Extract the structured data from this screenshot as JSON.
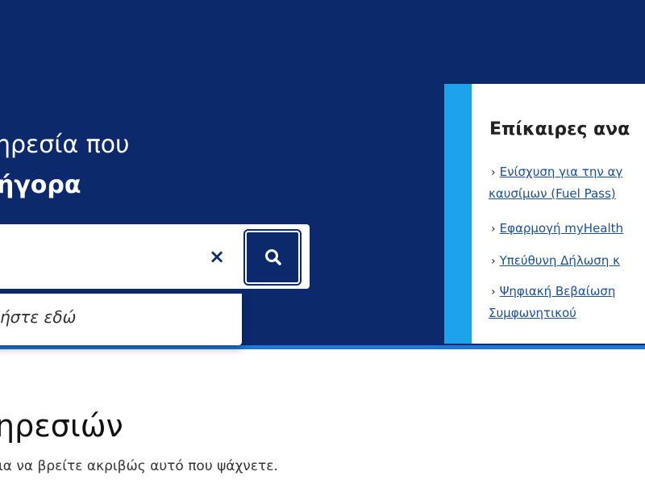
{
  "hero": {
    "line1": "ηρεσία που",
    "line2": "ήγορα"
  },
  "search": {
    "value": "",
    "clear_label": "×",
    "search_icon": "search-icon"
  },
  "dropdown": {
    "hint": "ήστε εδώ"
  },
  "news": {
    "title": "Επίκαιρες ανα",
    "items": [
      {
        "line1": "Ενίσχυση για την αγ",
        "line2": "καυσίμων (Fuel Pass)"
      },
      {
        "line1": "Εφαρμογή myHealth"
      },
      {
        "line1": "Υπεύθυνη Δήλωση κ"
      },
      {
        "line1": "Ψηφιακή Βεβαίωση",
        "line2": "Συμφωνητικού"
      }
    ],
    "bullet": "›"
  },
  "section": {
    "heading": "ηρεσιών",
    "subtitle": "ια να βρείτε ακριβώς αυτό που ψάχνετε."
  },
  "colors": {
    "hero_bg": "#0c2a6b",
    "accent": "#1ca3ec",
    "divider": "#1f78d8",
    "link": "#1a4fa0"
  }
}
